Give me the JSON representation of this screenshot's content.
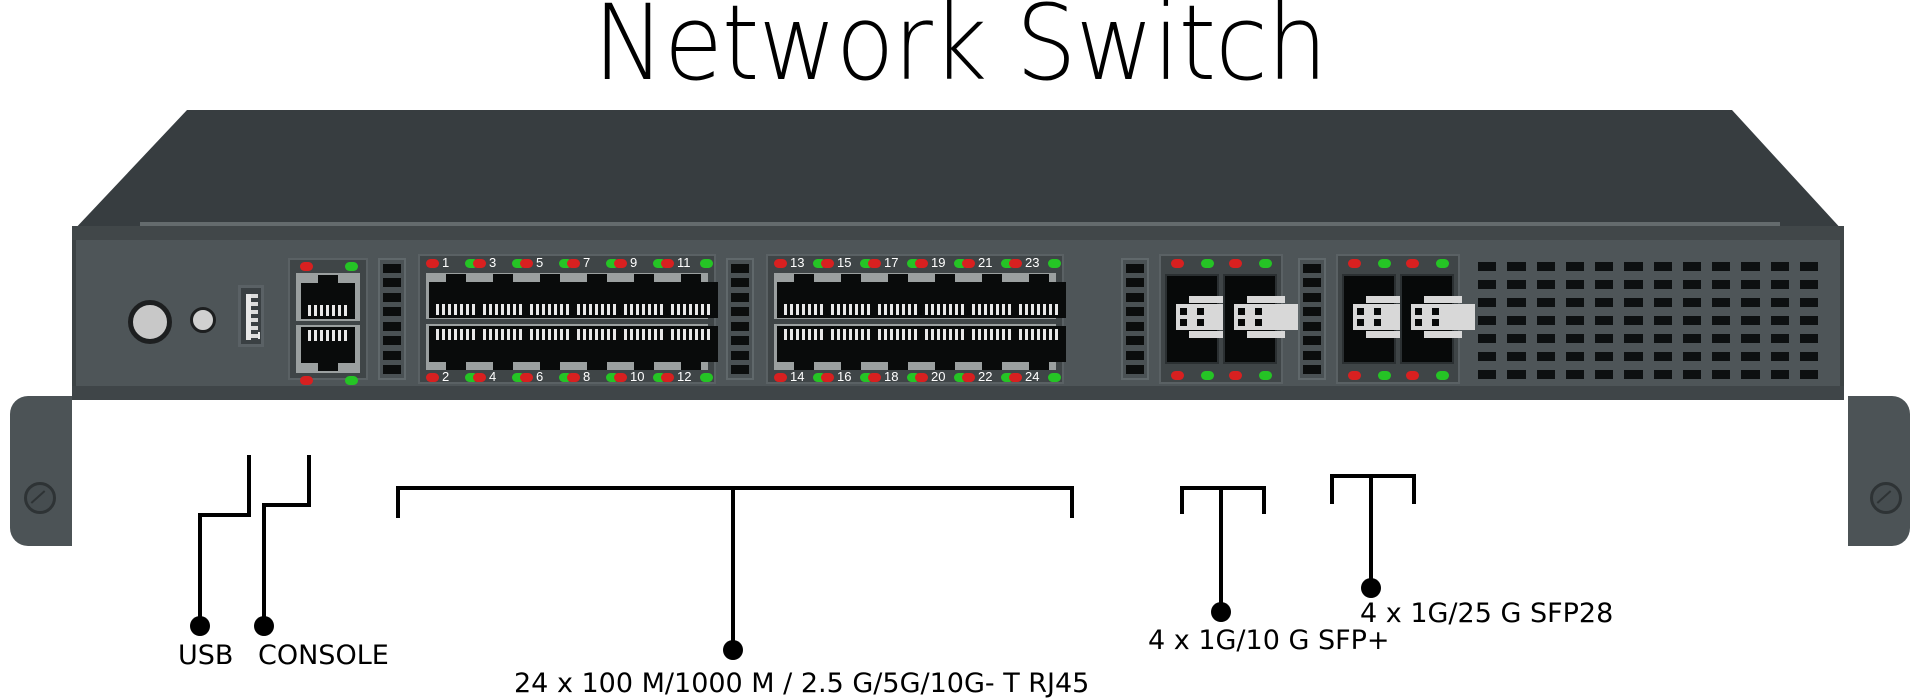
{
  "title": "Network Switch",
  "device": {
    "name": "network-switch-front-panel",
    "colors": {
      "chassis": "#4e5558",
      "lid": "#373d40",
      "port_block": "#3f4547",
      "rj45_plate": "#9ba0a0",
      "led_red": "#d82020",
      "led_green": "#25c425",
      "label_text": "#000000",
      "port_number_text": "#ffffff"
    },
    "controls": {
      "reset_button": "reset",
      "led_mode_button": "mode",
      "usb_port": "usb-port"
    },
    "console": {
      "label": "CONSOLE",
      "port_count": 2,
      "leds": [
        "red",
        "green",
        "red",
        "green"
      ]
    },
    "rj45": {
      "total": 24,
      "blocks": [
        {
          "top_ports": [
            1,
            3,
            5,
            7,
            9,
            11
          ],
          "bottom_ports": [
            2,
            4,
            6,
            8,
            10,
            12
          ]
        },
        {
          "top_ports": [
            13,
            15,
            17,
            19,
            21,
            23
          ],
          "bottom_ports": [
            14,
            16,
            18,
            20,
            22,
            24
          ]
        }
      ],
      "led_pair": [
        "red",
        "green"
      ]
    },
    "sfp": {
      "groups": [
        {
          "name": "sfp-plus-group",
          "cages": 2,
          "leds_top": [
            "red",
            "green",
            "red",
            "green"
          ],
          "leds_bottom": [
            "red",
            "green",
            "red",
            "green"
          ]
        },
        {
          "name": "sfp28-group",
          "cages": 2,
          "leds_top": [
            "red",
            "green",
            "red",
            "green"
          ],
          "leds_bottom": [
            "red",
            "green",
            "red",
            "green"
          ]
        }
      ]
    },
    "ventilation": {
      "columns": 12,
      "rows": 7
    }
  },
  "callouts": [
    {
      "id": "usb",
      "label": "USB"
    },
    {
      "id": "console",
      "label": "CONSOLE"
    },
    {
      "id": "rj45",
      "label": "24 x 100 M/1000 M / 2.5 G/5G/10G- T RJ45"
    },
    {
      "id": "sfpplus",
      "label": "4 x 1G/10 G SFP+"
    },
    {
      "id": "sfp28",
      "label": "4 x 1G/25 G SFP28"
    }
  ]
}
